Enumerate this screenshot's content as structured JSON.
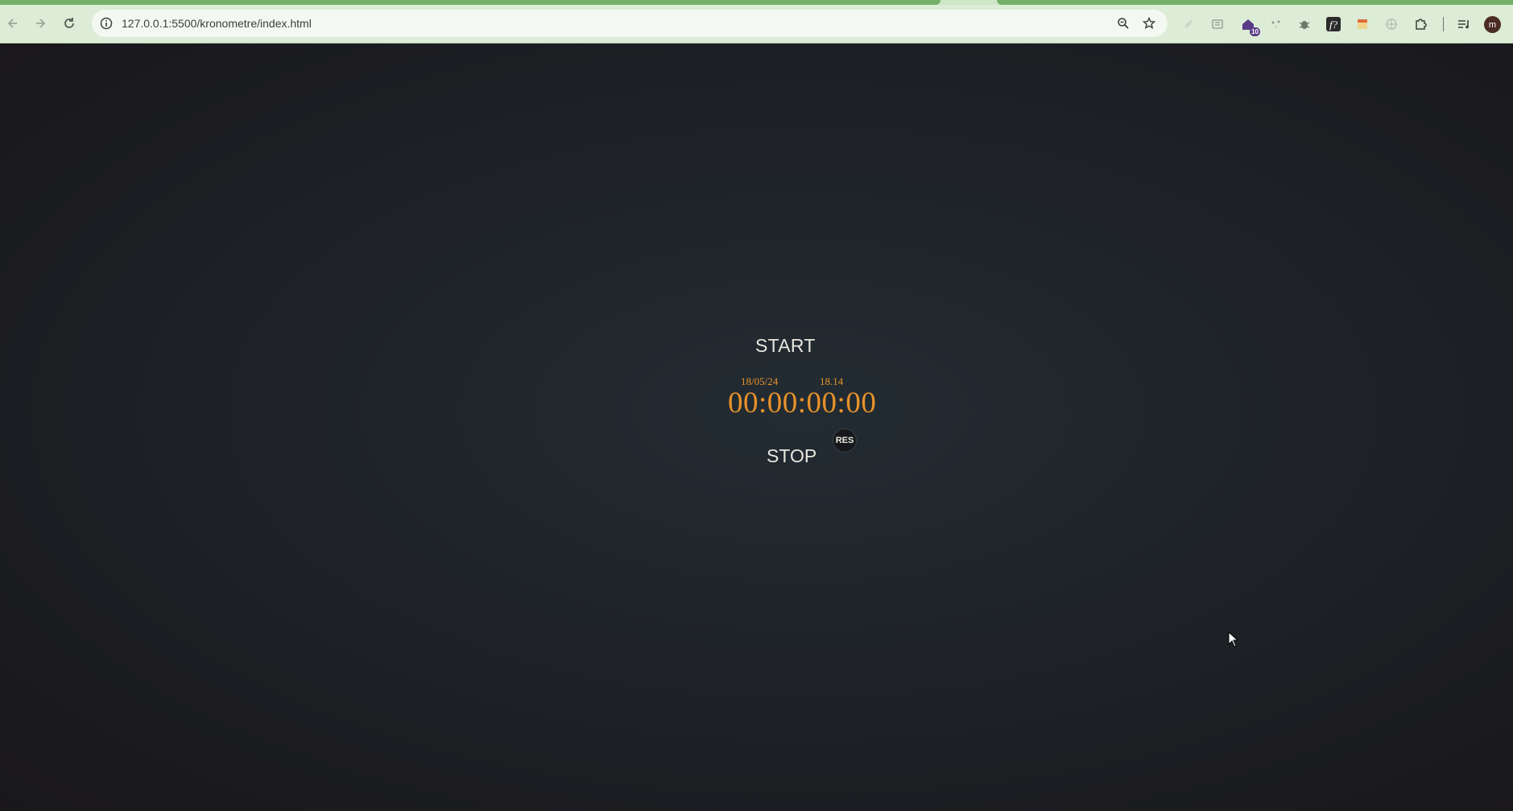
{
  "browser": {
    "url": "127.0.0.1:5500/kronometre/index.html",
    "extensions": [
      {
        "icon": "pen-icon"
      },
      {
        "icon": "cube-icon"
      },
      {
        "icon": "house-icon",
        "badge": "10"
      },
      {
        "icon": "dots-icon"
      },
      {
        "icon": "bug-icon"
      },
      {
        "icon": "font-icon",
        "label": "f?"
      },
      {
        "icon": "calendar-icon"
      },
      {
        "icon": "globe-icon"
      },
      {
        "icon": "puzzle-icon"
      }
    ],
    "profile_initial": "m"
  },
  "stopwatch": {
    "start_label": "START",
    "stop_label": "STOP",
    "reset_label": "RES",
    "date": "18/05/24",
    "time": "18.14",
    "counter": "00:00:00:00"
  },
  "colors": {
    "accent": "#e7922a",
    "text": "#e8e6df",
    "background": "#1e2227",
    "chrome": "#dcecd6"
  }
}
